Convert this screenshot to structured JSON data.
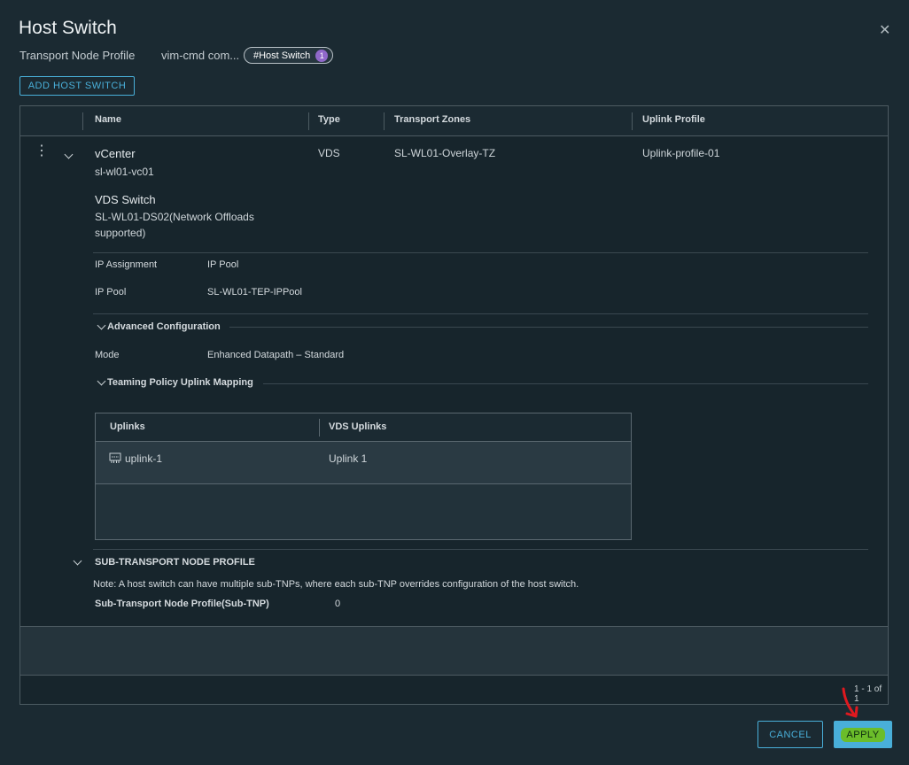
{
  "dialog": {
    "title": "Host Switch",
    "close_glyph": "✕"
  },
  "breadcrumb": {
    "item1": "Transport Node Profile",
    "item2": "vim-cmd com...",
    "pill_label": "#Host Switch",
    "pill_count": "1"
  },
  "toolbar": {
    "add_label": "ADD HOST SWITCH"
  },
  "table": {
    "columns": [
      "Name",
      "Type",
      "Transport Zones",
      "Uplink Profile"
    ],
    "row": {
      "vcenter_label": "vCenter",
      "vcenter_value": "sl-wl01-vc01",
      "type": "VDS",
      "transport_zones": "SL-WL01-Overlay-TZ",
      "uplink_profile": "Uplink-profile-01",
      "vds_label": "VDS Switch",
      "vds_value_line1": "SL-WL01-DS02(Network Offloads",
      "vds_value_line2": "supported)",
      "ip_assignment_label": "IP Assignment",
      "ip_assignment_value": "IP Pool",
      "ip_pool_label": "IP Pool",
      "ip_pool_value": "SL-WL01-TEP-IPPool",
      "advanced_label": "Advanced Configuration",
      "mode_label": "Mode",
      "mode_value": "Enhanced Datapath – Standard",
      "teaming_label": "Teaming Policy Uplink Mapping",
      "uplinks_table": {
        "columns": [
          "Uplinks",
          "VDS Uplinks"
        ],
        "rows": [
          {
            "uplink": "uplink-1",
            "vds_uplink": "Uplink 1"
          }
        ]
      },
      "sub_tnp_header": "SUB-TRANSPORT NODE PROFILE",
      "sub_tnp_note": "Note: A host switch can have multiple sub-TNPs, where each sub-TNP overrides configuration of the host switch.",
      "sub_tnp_label": "Sub-Transport Node Profile(Sub-TNP)",
      "sub_tnp_count": "0"
    },
    "pagination": "1 - 1 of 1"
  },
  "actions": {
    "cancel_label": "CANCEL",
    "apply_label": "APPLY"
  },
  "colors": {
    "background": "#1b2a32",
    "accent": "#49afd9",
    "badge": "#8f68c9",
    "highlight": "#6bbd2a",
    "annotation_arrow": "#e0191f"
  },
  "icons": [
    "close-icon",
    "kebab-icon",
    "chevron-down-icon",
    "uplink-icon",
    "red-arrow-annotation-icon"
  ]
}
